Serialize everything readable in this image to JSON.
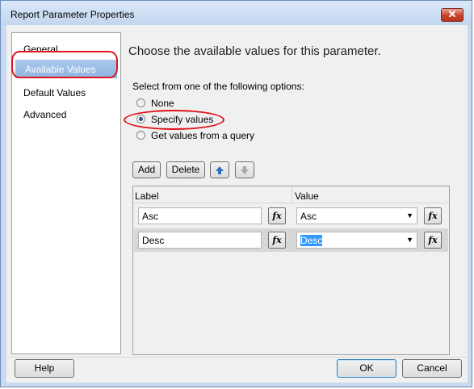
{
  "window": {
    "title": "Report Parameter Properties",
    "close_glyph": "✕"
  },
  "sidebar": {
    "items": [
      {
        "label": "General"
      },
      {
        "label": "Available Values"
      },
      {
        "label": "Default Values"
      },
      {
        "label": "Advanced"
      }
    ]
  },
  "main": {
    "heading": "Choose the available values for this parameter.",
    "prompt": "Select from one of the following options:",
    "options": [
      {
        "label": "None",
        "selected": false
      },
      {
        "label": "Specify values",
        "selected": true
      },
      {
        "label": "Get values from a query",
        "selected": false
      }
    ],
    "toolbar": {
      "add_label": "Add",
      "delete_label": "Delete",
      "up_icon": "arrow-up-icon",
      "down_icon": "arrow-down-icon"
    },
    "grid": {
      "columns": [
        "Label",
        "Value"
      ],
      "rows": [
        {
          "label": "Asc",
          "value": "Asc",
          "fx": "fx"
        },
        {
          "label": "Desc",
          "value": "Desc",
          "fx": "fx"
        }
      ]
    }
  },
  "footer": {
    "help_label": "Help",
    "ok_label": "OK",
    "cancel_label": "Cancel"
  },
  "colors": {
    "accent": "#3399ff",
    "annotation": "#e1141b",
    "selected_nav": "#8fb4e0"
  }
}
